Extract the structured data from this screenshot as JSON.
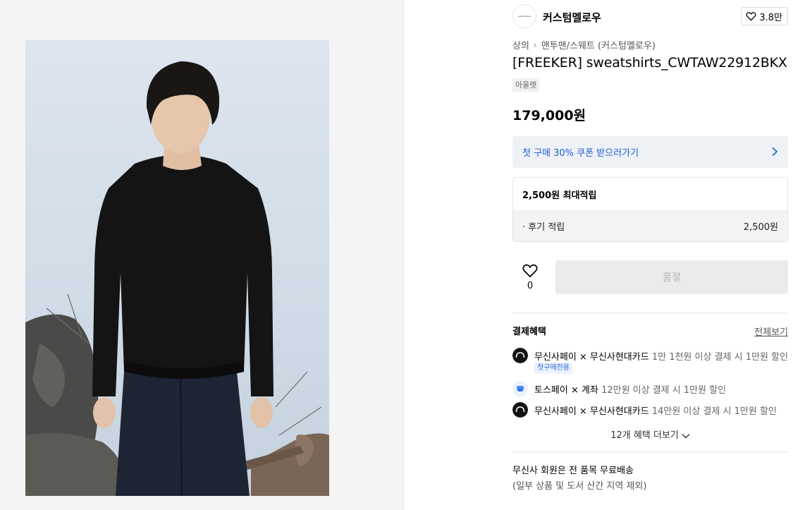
{
  "brand": {
    "logo_text": "customellow",
    "name": "커스텀멜로우",
    "like_count": "3.8만"
  },
  "breadcrumb": {
    "category": "상의",
    "subcategory": "맨투맨/스웨트 (커스텀멜로우)"
  },
  "product": {
    "title": "[FREEKER] sweatshirts_CWTAW22912BKX",
    "tag": "아울렛",
    "price": "179,000원"
  },
  "coupon": {
    "label": "첫 구매 30% 쿠폰 받으러가기"
  },
  "points": {
    "header": "2,500원 최대적립",
    "rows": [
      {
        "label": "· 후기 적립",
        "value": "2,500원"
      }
    ]
  },
  "purchase": {
    "wish_count": "0",
    "soldout_label": "품절"
  },
  "benefits": {
    "title": "결제혜택",
    "see_all": "전체보기",
    "items": [
      {
        "name": "무신사페이 × 무신사현대카드",
        "desc": "1만 1천원 이상 결제 시 1만원 할인",
        "badge": "첫구매전용",
        "icon": "musinsa-pay-icon"
      },
      {
        "name": "토스페이 × 계좌",
        "desc": "12만원 이상 결제 시 1만원 할인",
        "badge": "",
        "icon": "toss-pay-icon"
      },
      {
        "name": "무신사페이 × 무신사현대카드",
        "desc": "14만원 이상 결제 시 1만원 할인",
        "badge": "",
        "icon": "musinsa-pay-icon"
      }
    ],
    "more_label": "12개 혜택 더보기"
  },
  "shipping": {
    "line1": "무신사 회원은 전 품목 무료배송",
    "line2": "(일부 상품 및 도서 산간 지역 제외)"
  },
  "colors": {
    "accent_blue": "#1e5bd6",
    "coupon_bg": "#eef1f5",
    "soldout_bg": "#ebebeb",
    "soldout_text": "#b9b9b9"
  }
}
